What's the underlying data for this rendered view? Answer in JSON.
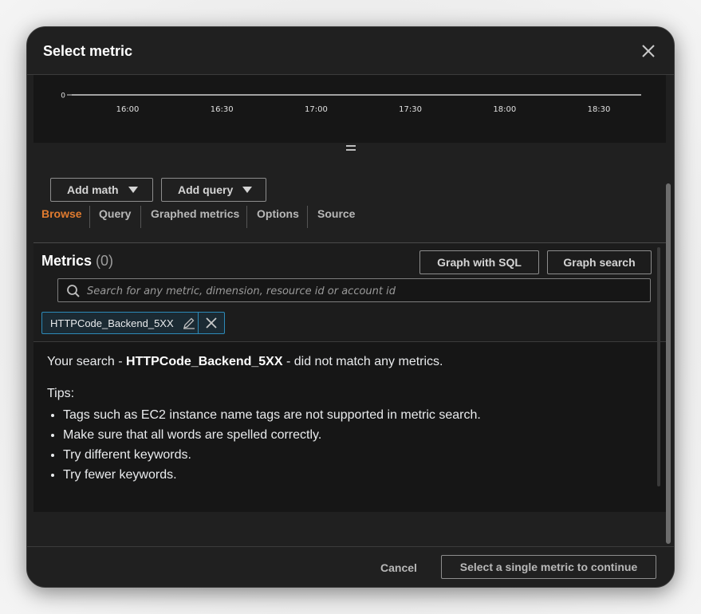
{
  "dialog": {
    "title": "Select metric"
  },
  "chart_data": {
    "type": "line",
    "y_ticks": [
      "0"
    ],
    "x_ticks": [
      "16:00",
      "16:30",
      "17:00",
      "17:30",
      "18:00",
      "18:30"
    ],
    "series": [],
    "grid": false
  },
  "toolbar": {
    "add_math": "Add math",
    "add_query": "Add query"
  },
  "tabs": [
    "Browse",
    "Query",
    "Graphed metrics",
    "Options",
    "Source"
  ],
  "metrics": {
    "title": "Metrics",
    "count": "(0)",
    "graph_sql": "Graph with SQL",
    "graph_search": "Graph search",
    "search_placeholder": "Search for any metric, dimension, resource id or account id",
    "token": "HTTPCode_Backend_5XX"
  },
  "result": {
    "prefix": "Your search - ",
    "term": "HTTPCode_Backend_5XX",
    "suffix": " - did not match any metrics.",
    "tips_title": "Tips:",
    "tips": [
      "Tags such as EC2 instance name tags are not supported in metric search.",
      "Make sure that all words are spelled correctly.",
      "Try different keywords.",
      "Try fewer keywords."
    ]
  },
  "footer": {
    "cancel": "Cancel",
    "continue": "Select a single metric to continue"
  }
}
